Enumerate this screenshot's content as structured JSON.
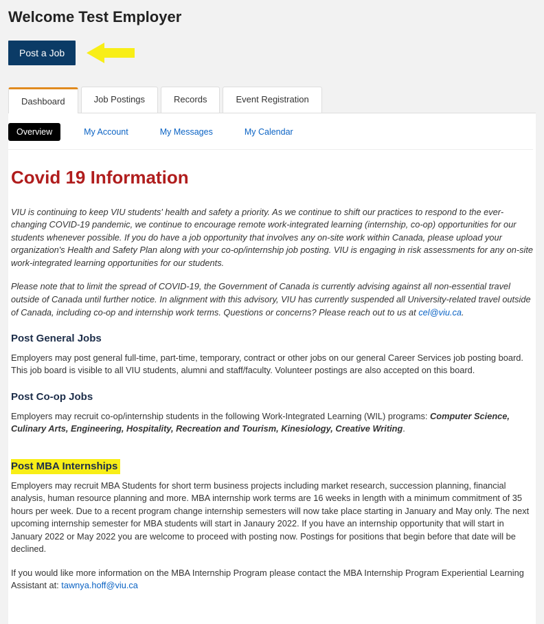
{
  "header": {
    "welcome": "Welcome Test Employer",
    "post_job_label": "Post a Job"
  },
  "tabs": {
    "main": [
      "Dashboard",
      "Job Postings",
      "Records",
      "Event Registration"
    ],
    "sub": [
      "Overview",
      "My Account",
      "My Messages",
      "My Calendar"
    ]
  },
  "covid": {
    "title": "Covid 19 Information",
    "p1": "VIU is continuing to keep VIU students' health and safety a priority. As we continue to shift our practices to respond to the ever-changing COVID-19 pandemic, we continue to encourage remote work-integrated learning (internship, co-op) opportunities for our students whenever possible. If you do have a job opportunity that involves any on-site work within Canada, please upload your organization's Health and Safety Plan along with your co-op/internship job posting. VIU is engaging in risk assessments for any on-site work-integrated learning opportunities for our students.",
    "p2_prefix": "Please note that to limit the spread of COVID-19, the Government of Canada is currently advising against all non-essential travel outside of Canada until further notice. In alignment with this advisory, VIU has currently suspended all University-related travel outside of Canada, including co-op and internship work terms. Questions or concerns? Please reach out to us at ",
    "p2_link": "cel@viu.ca",
    "p2_suffix": "."
  },
  "sections": {
    "general": {
      "title": "Post General Jobs",
      "body": "Employers may post general full-time, part-time, temporary, contract or other jobs on our general Career Services job posting board. This job board is visible to all VIU students, alumni and staff/faculty.  Volunteer postings are also accepted on this board."
    },
    "coop": {
      "title": "Post Co-op Jobs",
      "body_prefix": "Employers may recruit co-op/internship students in the following Work-Integrated Learning (WIL) programs: ",
      "programs": "Computer Science, Culinary Arts, Engineering, Hospitality,  Recreation and Tourism, Kinesiology, Creative Writing",
      "body_suffix": "."
    },
    "mba": {
      "title": "Post MBA Internships",
      "body": "Employers may recruit MBA Students for short term business projects including market research, succession planning, financial analysis, human resource planning and more.  MBA internship work terms are 16 weeks in length with a minimum commitment of 35 hours per week. Due to a recent program change internship semesters will now take place starting in January and May only.  The next upcoming internship semester for MBA students will start in Janaury 2022.  If you have an internship opportunity that will start in January 2022 or May 2022 you are welcome to proceed with posting now.  Postings for positions that begin before that date will be declined.",
      "contact_prefix": "If you would like more information on the MBA Internship Program please contact the MBA Internship Program Experiential Learning Assistant at: ",
      "contact_link": "tawnya.hoff@viu.ca"
    }
  }
}
